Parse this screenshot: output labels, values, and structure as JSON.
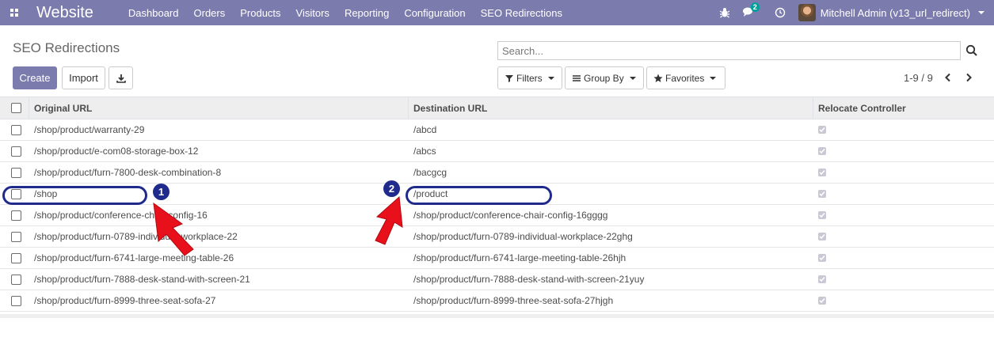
{
  "navbar": {
    "app_name": "Website",
    "menu": [
      "Dashboard",
      "Orders",
      "Products",
      "Visitors",
      "Reporting",
      "Configuration",
      "SEO Redirections"
    ],
    "chat_badge": "2",
    "user": "Mitchell Admin (v13_url_redirect)",
    "icons": [
      "apps-icon",
      "bug-icon",
      "chat-icon",
      "clock-icon",
      "avatar"
    ]
  },
  "control_panel": {
    "title": "SEO Redirections",
    "create_label": "Create",
    "import_label": "Import",
    "search_placeholder": "Search...",
    "filters_label": "Filters",
    "group_by_label": "Group By",
    "favorites_label": "Favorites",
    "pager": "1-9 / 9"
  },
  "table": {
    "headers": {
      "original": "Original URL",
      "destination": "Destination URL",
      "relocate": "Relocate Controller"
    },
    "rows": [
      {
        "original": "/shop/product/warranty-29",
        "destination": "/abcd",
        "relocate": true
      },
      {
        "original": "/shop/product/e-com08-storage-box-12",
        "destination": "/abcs",
        "relocate": true
      },
      {
        "original": "/shop/product/furn-7800-desk-combination-8",
        "destination": "/bacgcg",
        "relocate": true
      },
      {
        "original": "/shop",
        "destination": "/product",
        "relocate": true
      },
      {
        "original": "/shop/product/conference-chair-config-16",
        "destination": "/shop/product/conference-chair-config-16gggg",
        "relocate": true
      },
      {
        "original": "/shop/product/furn-0789-individual-workplace-22",
        "destination": "/shop/product/furn-0789-individual-workplace-22ghg",
        "relocate": true
      },
      {
        "original": "/shop/product/furn-6741-large-meeting-table-26",
        "destination": "/shop/product/furn-6741-large-meeting-table-26hjh",
        "relocate": true
      },
      {
        "original": "/shop/product/furn-7888-desk-stand-with-screen-21",
        "destination": "/shop/product/furn-7888-desk-stand-with-screen-21yuy",
        "relocate": true
      },
      {
        "original": "/shop/product/furn-8999-three-seat-sofa-27",
        "destination": "/shop/product/furn-8999-three-seat-sofa-27hjgh",
        "relocate": true
      }
    ]
  },
  "annotations": {
    "marker_1": "1",
    "marker_2": "2",
    "highlight_color": "#1f2a8c",
    "arrow_color": "#e8101a"
  },
  "colors": {
    "navbar": "#7c7bad",
    "primary_button": "#7c7bad",
    "header_bg": "#eeeeee"
  }
}
